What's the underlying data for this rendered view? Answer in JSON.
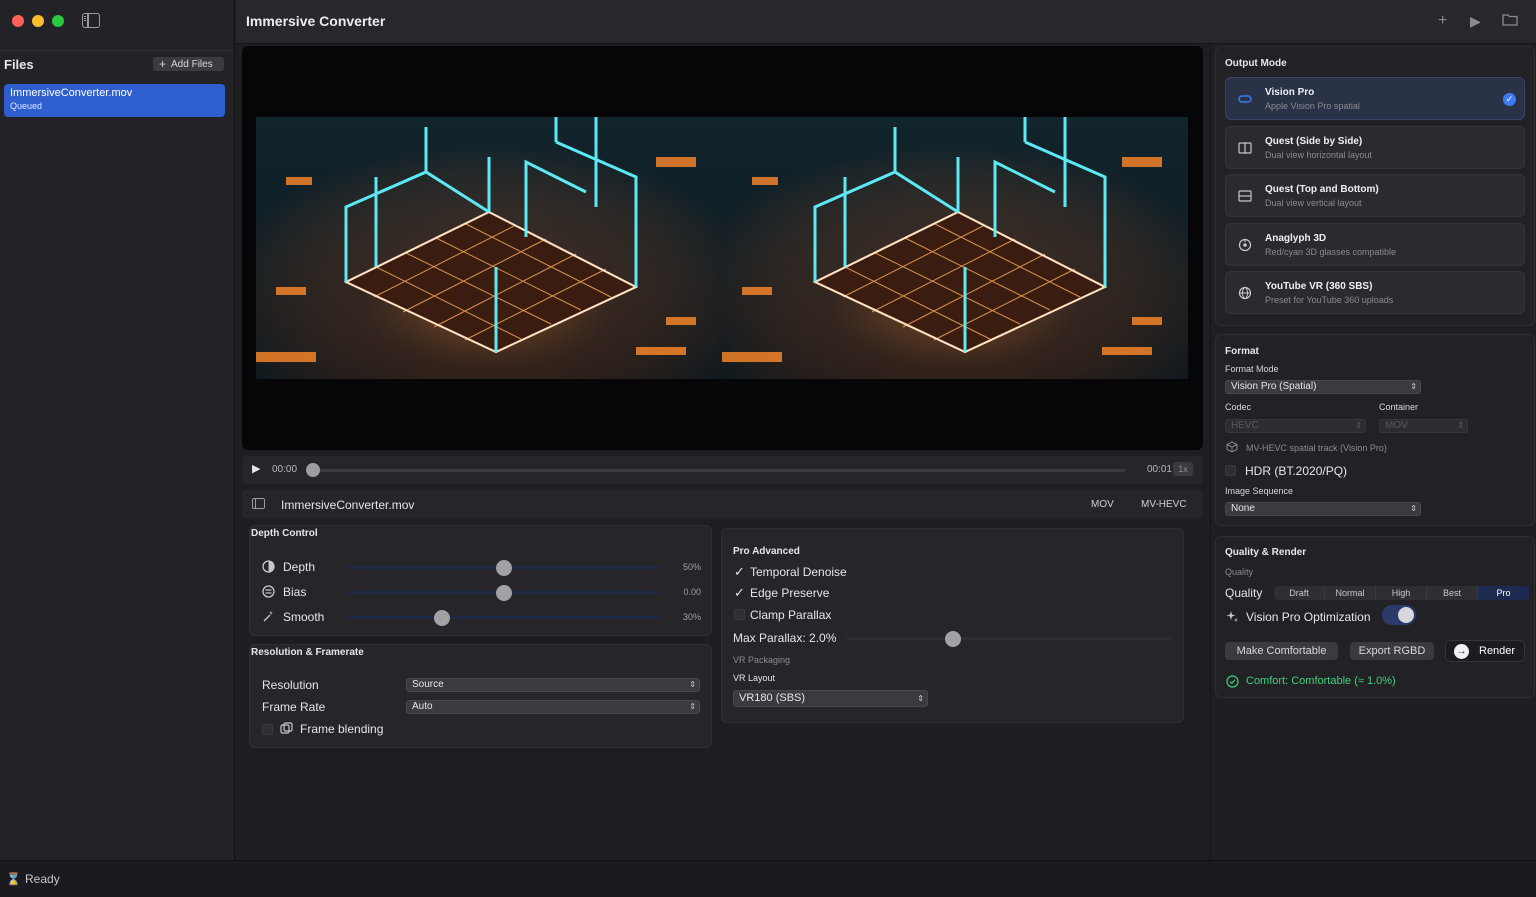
{
  "window": {
    "title": "Immersive Converter"
  },
  "sidebar": {
    "title": "Files",
    "add_label": "Add Files",
    "files": [
      {
        "name": "ImmersiveConverter.mov",
        "status": "Queued"
      }
    ]
  },
  "playback": {
    "current_time": "00:00",
    "end_time": "00:01",
    "speed": "1x",
    "progress": 0.0
  },
  "file_info": {
    "name": "ImmersiveConverter.mov",
    "container": "MOV",
    "codec": "MV-HEVC"
  },
  "depth_control": {
    "title": "Depth Control",
    "sliders": [
      {
        "label": "Depth",
        "value_text": "50%",
        "value": 0.5,
        "icon": "contrast-icon"
      },
      {
        "label": "Bias",
        "value_text": "0.00",
        "value": 0.5,
        "icon": "bias-icon"
      },
      {
        "label": "Smooth",
        "value_text": "30%",
        "value": 0.3,
        "icon": "wand-icon"
      }
    ]
  },
  "resolution_framerate": {
    "title": "Resolution & Framerate",
    "resolution_label": "Resolution",
    "resolution_value": "Source",
    "frame_rate_label": "Frame Rate",
    "frame_rate_value": "Auto",
    "frame_blending_label": "Frame blending"
  },
  "pro_advanced": {
    "title": "Pro Advanced",
    "temporal_denoise": "Temporal Denoise",
    "edge_preserve": "Edge Preserve",
    "clamp_parallax": "Clamp Parallax",
    "max_parallax_label": "Max Parallax: 2.0%",
    "max_parallax_value": 0.33,
    "vr_packaging_label": "VR Packaging",
    "vr_layout_label": "VR Layout",
    "vr_layout_value": "VR180 (SBS)"
  },
  "output_mode": {
    "title": "Output Mode",
    "modes": [
      {
        "title": "Vision Pro",
        "subtitle": "Apple Vision Pro spatial",
        "icon": "vision-pro-icon",
        "selected": true
      },
      {
        "title": "Quest (Side by Side)",
        "subtitle": "Dual view horizontal layout",
        "icon": "side-by-side-icon",
        "selected": false
      },
      {
        "title": "Quest (Top and Bottom)",
        "subtitle": "Dual view vertical layout",
        "icon": "top-bottom-icon",
        "selected": false
      },
      {
        "title": "Anaglyph 3D",
        "subtitle": "Red/cyan 3D glasses compatible",
        "icon": "anaglyph-icon",
        "selected": false
      },
      {
        "title": "YouTube VR (360 SBS)",
        "subtitle": "Preset for YouTube 360 uploads",
        "icon": "globe-icon",
        "selected": false
      }
    ]
  },
  "format": {
    "title": "Format",
    "format_mode_label": "Format Mode",
    "format_mode_value": "Vision Pro (Spatial)",
    "codec_label": "Codec",
    "codec_value": "HEVC",
    "container_label": "Container",
    "container_value": "MOV",
    "mv_hevc_note": "MV-HEVC spatial track (Vision Pro)",
    "hdr_label": "HDR (BT.2020/PQ)",
    "image_sequence_label": "Image Sequence",
    "image_sequence_value": "None"
  },
  "quality_render": {
    "title": "Quality & Render",
    "quality_caption": "Quality",
    "quality_label": "Quality",
    "options": [
      "Draft",
      "Normal",
      "High",
      "Best",
      "Pro"
    ],
    "selected": "Pro",
    "optimization_label": "Vision Pro Optimization",
    "make_comfortable_label": "Make Comfortable",
    "export_rgbd_label": "Export RGBD",
    "render_label": "Render",
    "comfort_text": "Comfort: Comfortable (≈ 1.0%)"
  },
  "status": {
    "text": "Ready"
  },
  "colors": {
    "accent": "#3a7bf6",
    "selection": "#2f5fcf",
    "success": "#3fd17a"
  }
}
